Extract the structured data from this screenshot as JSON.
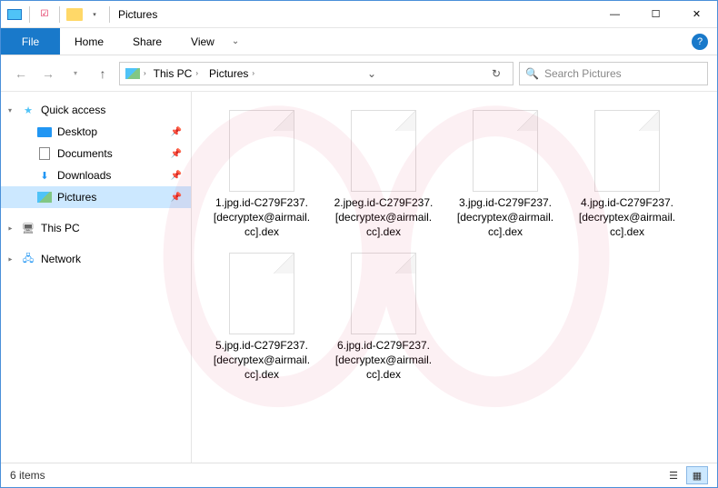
{
  "titlebar": {
    "title": "Pictures"
  },
  "window_controls": {
    "minimize": "—",
    "maximize": "☐",
    "close": "✕"
  },
  "ribbon": {
    "file": "File",
    "tabs": [
      "Home",
      "Share",
      "View"
    ],
    "help": "?"
  },
  "address": {
    "parts": [
      "This PC",
      "Pictures"
    ]
  },
  "search": {
    "placeholder": "Search Pictures"
  },
  "sidebar": {
    "quick_access": "Quick access",
    "items": [
      {
        "label": "Desktop",
        "pinned": true
      },
      {
        "label": "Documents",
        "pinned": true
      },
      {
        "label": "Downloads",
        "pinned": true
      },
      {
        "label": "Pictures",
        "pinned": true,
        "selected": true
      }
    ],
    "this_pc": "This PC",
    "network": "Network"
  },
  "files": [
    "1.jpg.id-C279F237.[decryptex@airmail.cc].dex",
    "2.jpeg.id-C279F237.[decryptex@airmail.cc].dex",
    "3.jpg.id-C279F237.[decryptex@airmail.cc].dex",
    "4.jpg.id-C279F237.[decryptex@airmail.cc].dex",
    "5.jpg.id-C279F237.[decryptex@airmail.cc].dex",
    "6.jpg.id-C279F237.[decryptex@airmail.cc].dex"
  ],
  "status": {
    "count_label": "6 items"
  }
}
